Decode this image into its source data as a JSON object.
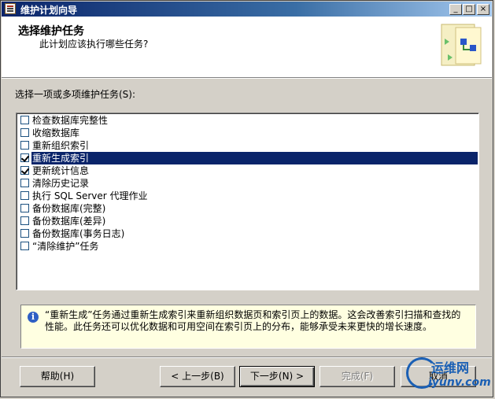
{
  "window": {
    "title": "维护计划向导",
    "min_glyph": "_",
    "max_glyph": "□",
    "close_glyph": "×"
  },
  "header": {
    "title": "选择维护任务",
    "subtitle": "此计划应该执行哪些任务?"
  },
  "tasks_label": "选择一项或多项维护任务(S):",
  "tasks": [
    {
      "label": "检查数据库完整性",
      "checked": false,
      "selected": false
    },
    {
      "label": "收缩数据库",
      "checked": false,
      "selected": false
    },
    {
      "label": "重新组织索引",
      "checked": false,
      "selected": false
    },
    {
      "label": "重新生成索引",
      "checked": true,
      "selected": true
    },
    {
      "label": "更新统计信息",
      "checked": true,
      "selected": false
    },
    {
      "label": "清除历史记录",
      "checked": false,
      "selected": false
    },
    {
      "label": "执行 SQL Server 代理作业",
      "checked": false,
      "selected": false
    },
    {
      "label": "备份数据库(完整)",
      "checked": false,
      "selected": false
    },
    {
      "label": "备份数据库(差异)",
      "checked": false,
      "selected": false
    },
    {
      "label": "备份数据库(事务日志)",
      "checked": false,
      "selected": false
    },
    {
      "label": "“清除维护”任务",
      "checked": false,
      "selected": false
    }
  ],
  "description": "“重新生成”任务通过重新生成索引来重新组织数据页和索引页上的数据。这会改善索引扫描和查找的性能。此任务还可以优化数据和可用空间在索引页上的分布，能够承受未来更快的增长速度。",
  "buttons": {
    "help": "帮助(H)",
    "back": "< 上一步(B)",
    "next": "下一步(N) >",
    "finish": "完成(F)",
    "cancel": "取消"
  },
  "watermark": {
    "name": "运维网",
    "url": "iyunv.com"
  },
  "colors": {
    "selection": "#0a246a",
    "title_bar_start": "#0a246a",
    "info_background": "#ffffe1"
  }
}
